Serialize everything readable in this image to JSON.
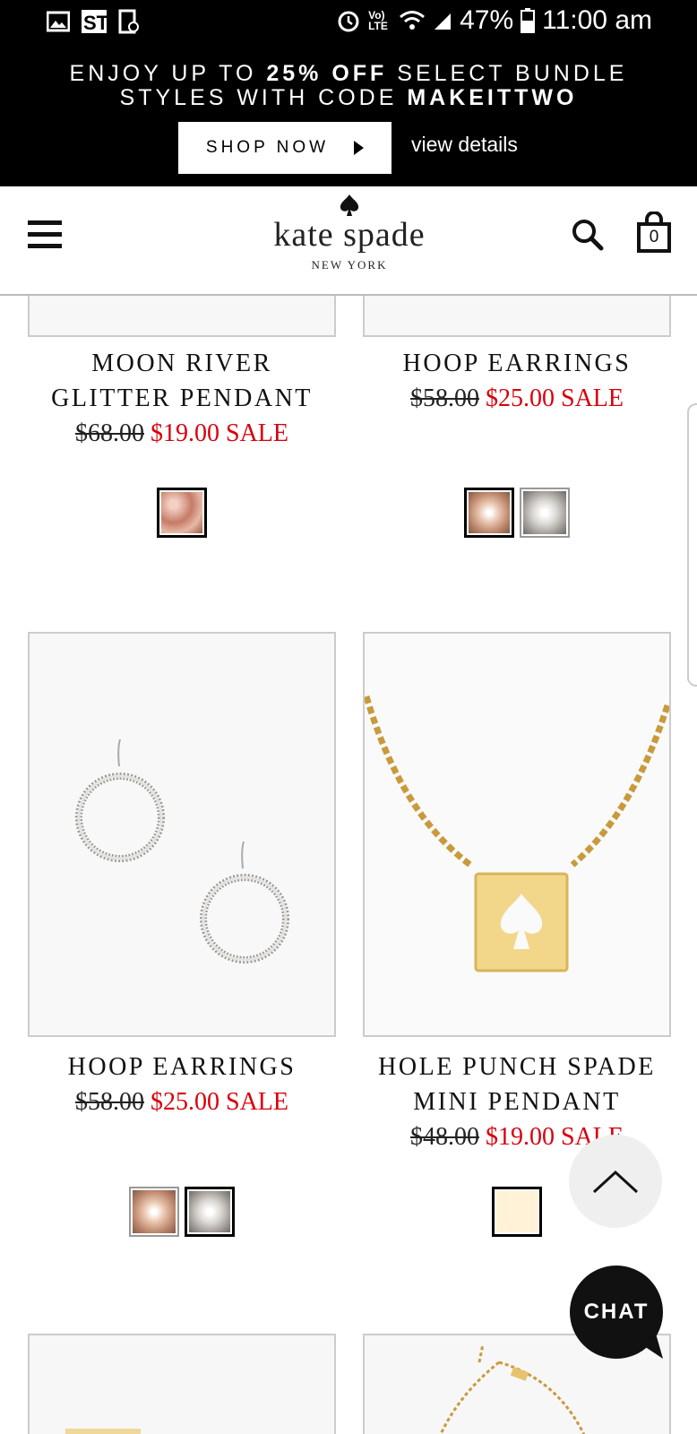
{
  "status_bar": {
    "battery": "47%",
    "time": "11:00 am",
    "network": "Vo) LTE"
  },
  "promo": {
    "line1_pre": "ENJOY UP TO ",
    "line1_bold": "25% OFF",
    "line1_post": " SELECT BUNDLE",
    "line2_pre": "STYLES WITH CODE ",
    "line2_bold": "MAKEITTWO",
    "shop_now": "SHOP NOW",
    "view_details": "view details"
  },
  "header": {
    "brand": "kate spade",
    "brand_sub": "NEW YORK",
    "bag_count": "0"
  },
  "products": [
    {
      "name_line1": "MOON RIVER",
      "name_line2": "GLITTER PENDANT",
      "original_price": "$68.00",
      "sale_price": "$19.00 SALE",
      "swatches": [
        "rose"
      ]
    },
    {
      "name_line1": "HOOP EARRINGS",
      "name_line2": "",
      "original_price": "$58.00",
      "sale_price": "$25.00 SALE",
      "swatches": [
        "rosegold",
        "clear"
      ]
    },
    {
      "name_line1": "HOOP EARRINGS",
      "name_line2": "",
      "original_price": "$58.00",
      "sale_price": "$25.00 SALE",
      "swatches": [
        "rosegold",
        "clear"
      ]
    },
    {
      "name_line1": "HOLE PUNCH SPADE",
      "name_line2": "MINI PENDANT",
      "original_price": "$48.00",
      "sale_price": "$19.00 SALE",
      "swatches": [
        "cream"
      ]
    }
  ],
  "floating": {
    "chat_label": "CHAT"
  }
}
